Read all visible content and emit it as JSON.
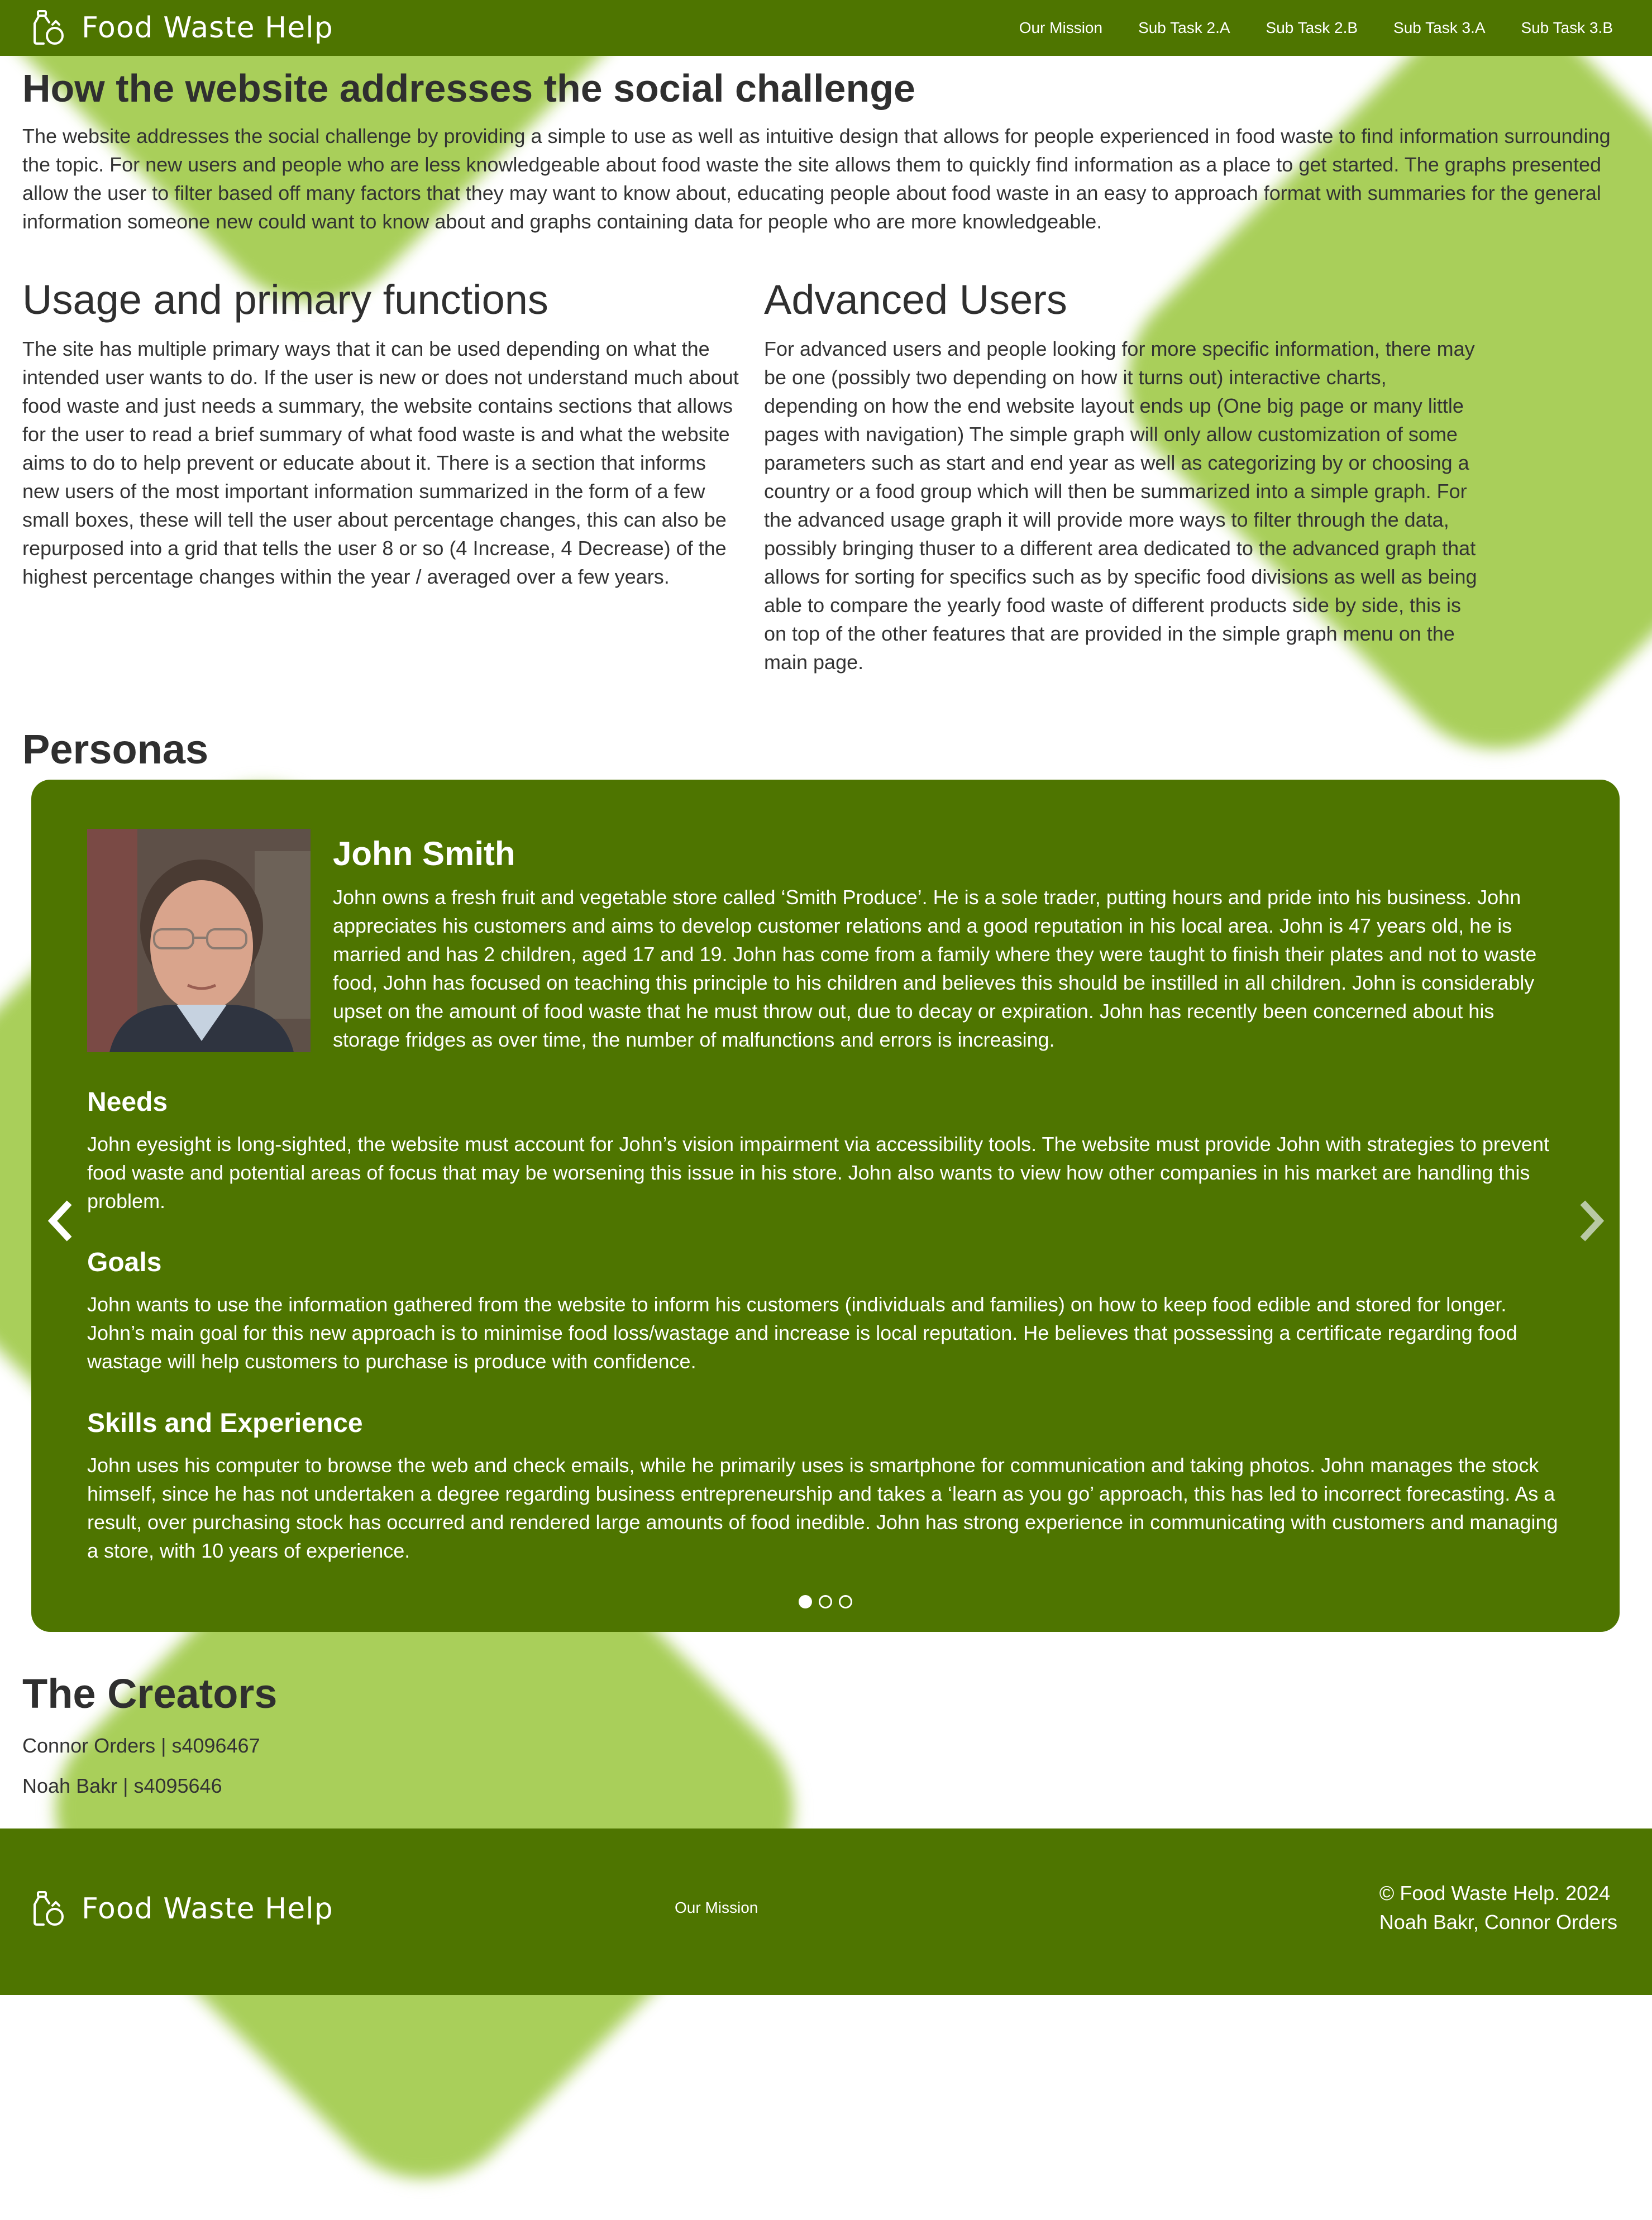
{
  "brand": {
    "name": "Food Waste Help"
  },
  "nav": {
    "links": [
      "Our Mission",
      "Sub Task 2.A",
      "Sub Task 2.B",
      "Sub Task 3.A",
      "Sub Task 3.B"
    ]
  },
  "intro": {
    "title": "How the website addresses the social challenge",
    "text": "The website addresses the social challenge by providing a simple to use as well as intuitive design that allows for people experienced in food waste to find information surrounding the topic. For new users and people who are less knowledgeable about food waste the site allows them to quickly find information as a place to get started. The graphs presented allow the user to filter based off many factors that they may want to know about, educating people about food waste in an easy to approach format with summaries for the general information someone new could want to know about and graphs containing data for people who are more knowledgeable."
  },
  "usage": {
    "title": "Usage and primary functions",
    "text": "The site has multiple primary ways that it can be used depending on what the intended user wants to do. If the user is new or does not understand much about food waste and just needs a summary, the website contains sections that allows for the user to read a brief summary of what food waste is and what the website aims to do to help prevent or educate about it. There is a section that informs new users of the most important information summarized in the form of a few small boxes, these will tell the user about percentage changes, this can also be repurposed into a grid that tells the user 8 or so (4 Increase, 4 Decrease) of the highest percentage changes within the year / averaged over a few years."
  },
  "advanced": {
    "title": "Advanced Users",
    "text": "For advanced users and people looking for more specific information, there may be one (possibly two depending on how it turns out) interactive charts, depending on how the end website layout ends up (One big page or many little pages with navigation) The simple graph will only allow customization of some parameters such as start and end year as well as categorizing by or choosing a country or a food group which will then be summarized into a simple graph. For the advanced usage graph it will provide more ways to filter through the data, possibly bringing thuser to a different area dedicated to the advanced graph that allows for sorting for specifics such as by specific food divisions as well as being able to compare the yearly food waste of different products side by side, this is on top of the other features that are provided in the simple graph menu on the main page."
  },
  "personas": {
    "title": "Personas",
    "persona": {
      "name": "John Smith",
      "bio": "John owns a fresh fruit and vegetable store called ‘Smith Produce’. He is a sole trader, putting hours and pride into his business. John appreciates his customers and aims to develop customer relations and a good reputation in his local area. John is 47 years old, he is married and has 2 children, aged 17 and 19. John has come from a family where they were taught to finish their plates and not to waste food, John has focused on teaching this principle to his children and believes this should be instilled in all children. John is considerably upset on the amount of food waste that he must throw out, due to decay or expiration. John has recently been concerned about his storage fridges as over time, the number of malfunctions and errors is increasing.",
      "needs_title": "Needs",
      "needs": "John eyesight is long-sighted, the website must account for John’s vision impairment via accessibility tools. The website must provide John with strategies to prevent food waste and potential areas of focus that may be worsening this issue in his store. John also wants to view how other companies in his market are handling this problem.",
      "goals_title": "Goals",
      "goals": "John wants to use the information gathered from the website to inform his customers (individuals and families) on how to keep food edible and stored for longer. John’s main goal for this new approach is to minimise food loss/wastage and increase is local reputation. He believes that possessing a certificate regarding food wastage will help customers to purchase is produce with confidence.",
      "skills_title": "Skills and Experience",
      "skills": "John uses his computer to browse the web and check emails, while he primarily uses is smartphone for communication and taking photos. John manages the stock himself, since he has not undertaken a degree regarding business entrepreneurship and takes a ‘learn as you go’ approach, this has led to incorrect forecasting. As a result, over purchasing stock has occurred and rendered large amounts of food inedible. John has strong experience in communicating with customers and managing a store, with 10 years of experience."
    },
    "active_slide": 1,
    "slide_count": 3
  },
  "creators": {
    "title": "The Creators",
    "people": [
      "Connor Orders | s4096467",
      "Noah Bakr | s4095646"
    ]
  },
  "footer": {
    "link": "Our Mission",
    "copyright": "© Food Waste Help. 2024",
    "authors": "Noah Bakr, Connor Orders"
  },
  "colors": {
    "primary": "#4e7500",
    "accent_bg": "#a9cf5a"
  }
}
